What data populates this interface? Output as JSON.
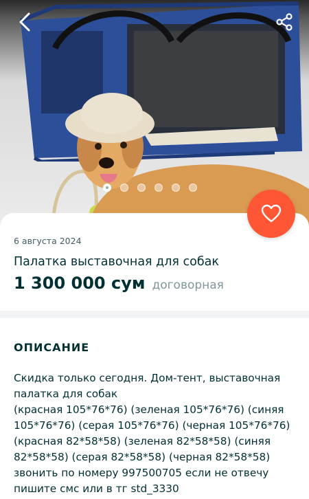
{
  "listing": {
    "date": "6 августа 2024",
    "title": "Палатка выставочная для собак",
    "price": "1 300 000 сум",
    "negotiable": "договорная"
  },
  "gallery": {
    "image_count": 6,
    "active_index": 0
  },
  "description": {
    "heading": "ОПИСАНИЕ",
    "lines": [
      "Скидка только сегодня. Дом-тент, выставочная",
      "палатка для собак",
      "(красная 105*76*76) (зеленая 105*76*76) (синяя",
      "105*76*76) (серая 105*76*76) (черная 105*76*76)",
      "(красная 82*58*58) (зеленая 82*58*58) (синяя",
      "82*58*58) (серая 82*58*58) (черная 82*58*58)",
      "звонить по номеру 997500705 если не отвечу",
      "пишите смс или в тг std_3330"
    ]
  },
  "icons": {
    "back": "chevron-left-icon",
    "share": "share-icon",
    "favorite": "heart-icon"
  },
  "colors": {
    "accent": "#ff5636",
    "text_primary": "#002f34",
    "text_secondary": "#7f9799",
    "carrier_blue": "#2d4f9a"
  }
}
